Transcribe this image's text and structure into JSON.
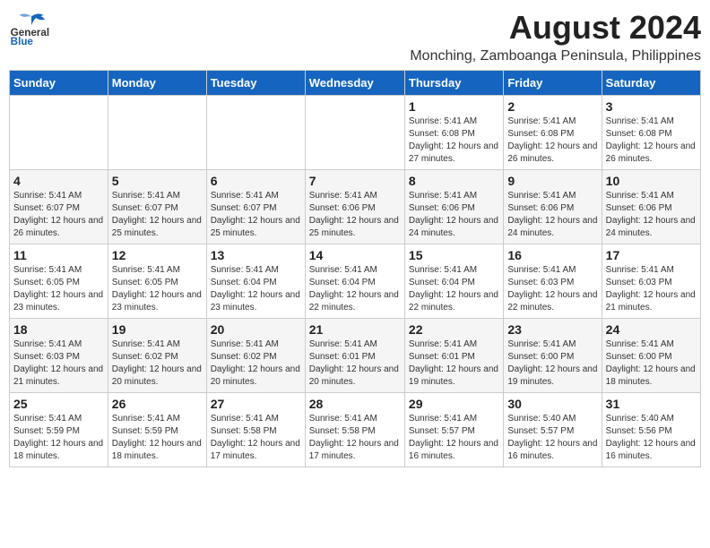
{
  "header": {
    "logo": {
      "general": "General",
      "blue": "Blue"
    },
    "title": "August 2024",
    "location": "Monching, Zamboanga Peninsula, Philippines"
  },
  "weekdays": [
    "Sunday",
    "Monday",
    "Tuesday",
    "Wednesday",
    "Thursday",
    "Friday",
    "Saturday"
  ],
  "weeks": [
    [
      {
        "day": "",
        "info": ""
      },
      {
        "day": "",
        "info": ""
      },
      {
        "day": "",
        "info": ""
      },
      {
        "day": "",
        "info": ""
      },
      {
        "day": "1",
        "sunrise": "Sunrise: 5:41 AM",
        "sunset": "Sunset: 6:08 PM",
        "daylight": "Daylight: 12 hours and 27 minutes."
      },
      {
        "day": "2",
        "sunrise": "Sunrise: 5:41 AM",
        "sunset": "Sunset: 6:08 PM",
        "daylight": "Daylight: 12 hours and 26 minutes."
      },
      {
        "day": "3",
        "sunrise": "Sunrise: 5:41 AM",
        "sunset": "Sunset: 6:08 PM",
        "daylight": "Daylight: 12 hours and 26 minutes."
      }
    ],
    [
      {
        "day": "4",
        "sunrise": "Sunrise: 5:41 AM",
        "sunset": "Sunset: 6:07 PM",
        "daylight": "Daylight: 12 hours and 26 minutes."
      },
      {
        "day": "5",
        "sunrise": "Sunrise: 5:41 AM",
        "sunset": "Sunset: 6:07 PM",
        "daylight": "Daylight: 12 hours and 25 minutes."
      },
      {
        "day": "6",
        "sunrise": "Sunrise: 5:41 AM",
        "sunset": "Sunset: 6:07 PM",
        "daylight": "Daylight: 12 hours and 25 minutes."
      },
      {
        "day": "7",
        "sunrise": "Sunrise: 5:41 AM",
        "sunset": "Sunset: 6:06 PM",
        "daylight": "Daylight: 12 hours and 25 minutes."
      },
      {
        "day": "8",
        "sunrise": "Sunrise: 5:41 AM",
        "sunset": "Sunset: 6:06 PM",
        "daylight": "Daylight: 12 hours and 24 minutes."
      },
      {
        "day": "9",
        "sunrise": "Sunrise: 5:41 AM",
        "sunset": "Sunset: 6:06 PM",
        "daylight": "Daylight: 12 hours and 24 minutes."
      },
      {
        "day": "10",
        "sunrise": "Sunrise: 5:41 AM",
        "sunset": "Sunset: 6:06 PM",
        "daylight": "Daylight: 12 hours and 24 minutes."
      }
    ],
    [
      {
        "day": "11",
        "sunrise": "Sunrise: 5:41 AM",
        "sunset": "Sunset: 6:05 PM",
        "daylight": "Daylight: 12 hours and 23 minutes."
      },
      {
        "day": "12",
        "sunrise": "Sunrise: 5:41 AM",
        "sunset": "Sunset: 6:05 PM",
        "daylight": "Daylight: 12 hours and 23 minutes."
      },
      {
        "day": "13",
        "sunrise": "Sunrise: 5:41 AM",
        "sunset": "Sunset: 6:04 PM",
        "daylight": "Daylight: 12 hours and 23 minutes."
      },
      {
        "day": "14",
        "sunrise": "Sunrise: 5:41 AM",
        "sunset": "Sunset: 6:04 PM",
        "daylight": "Daylight: 12 hours and 22 minutes."
      },
      {
        "day": "15",
        "sunrise": "Sunrise: 5:41 AM",
        "sunset": "Sunset: 6:04 PM",
        "daylight": "Daylight: 12 hours and 22 minutes."
      },
      {
        "day": "16",
        "sunrise": "Sunrise: 5:41 AM",
        "sunset": "Sunset: 6:03 PM",
        "daylight": "Daylight: 12 hours and 22 minutes."
      },
      {
        "day": "17",
        "sunrise": "Sunrise: 5:41 AM",
        "sunset": "Sunset: 6:03 PM",
        "daylight": "Daylight: 12 hours and 21 minutes."
      }
    ],
    [
      {
        "day": "18",
        "sunrise": "Sunrise: 5:41 AM",
        "sunset": "Sunset: 6:03 PM",
        "daylight": "Daylight: 12 hours and 21 minutes."
      },
      {
        "day": "19",
        "sunrise": "Sunrise: 5:41 AM",
        "sunset": "Sunset: 6:02 PM",
        "daylight": "Daylight: 12 hours and 20 minutes."
      },
      {
        "day": "20",
        "sunrise": "Sunrise: 5:41 AM",
        "sunset": "Sunset: 6:02 PM",
        "daylight": "Daylight: 12 hours and 20 minutes."
      },
      {
        "day": "21",
        "sunrise": "Sunrise: 5:41 AM",
        "sunset": "Sunset: 6:01 PM",
        "daylight": "Daylight: 12 hours and 20 minutes."
      },
      {
        "day": "22",
        "sunrise": "Sunrise: 5:41 AM",
        "sunset": "Sunset: 6:01 PM",
        "daylight": "Daylight: 12 hours and 19 minutes."
      },
      {
        "day": "23",
        "sunrise": "Sunrise: 5:41 AM",
        "sunset": "Sunset: 6:00 PM",
        "daylight": "Daylight: 12 hours and 19 minutes."
      },
      {
        "day": "24",
        "sunrise": "Sunrise: 5:41 AM",
        "sunset": "Sunset: 6:00 PM",
        "daylight": "Daylight: 12 hours and 18 minutes."
      }
    ],
    [
      {
        "day": "25",
        "sunrise": "Sunrise: 5:41 AM",
        "sunset": "Sunset: 5:59 PM",
        "daylight": "Daylight: 12 hours and 18 minutes."
      },
      {
        "day": "26",
        "sunrise": "Sunrise: 5:41 AM",
        "sunset": "Sunset: 5:59 PM",
        "daylight": "Daylight: 12 hours and 18 minutes."
      },
      {
        "day": "27",
        "sunrise": "Sunrise: 5:41 AM",
        "sunset": "Sunset: 5:58 PM",
        "daylight": "Daylight: 12 hours and 17 minutes."
      },
      {
        "day": "28",
        "sunrise": "Sunrise: 5:41 AM",
        "sunset": "Sunset: 5:58 PM",
        "daylight": "Daylight: 12 hours and 17 minutes."
      },
      {
        "day": "29",
        "sunrise": "Sunrise: 5:41 AM",
        "sunset": "Sunset: 5:57 PM",
        "daylight": "Daylight: 12 hours and 16 minutes."
      },
      {
        "day": "30",
        "sunrise": "Sunrise: 5:40 AM",
        "sunset": "Sunset: 5:57 PM",
        "daylight": "Daylight: 12 hours and 16 minutes."
      },
      {
        "day": "31",
        "sunrise": "Sunrise: 5:40 AM",
        "sunset": "Sunset: 5:56 PM",
        "daylight": "Daylight: 12 hours and 16 minutes."
      }
    ]
  ]
}
